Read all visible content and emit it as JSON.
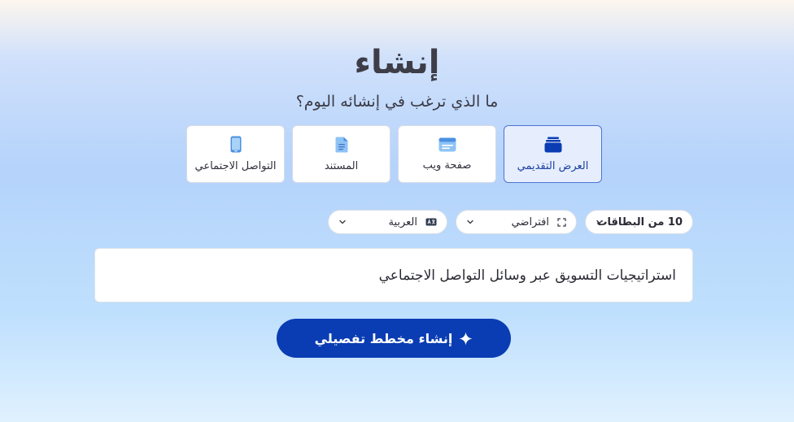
{
  "header": {
    "title": "إنشاء",
    "subtitle": "ما الذي ترغب في إنشائه اليوم؟"
  },
  "types": [
    {
      "label": "العرض التقديمي",
      "icon": "presentation-stack-icon",
      "selected": true
    },
    {
      "label": "صفحة ويب",
      "icon": "webpage-icon",
      "selected": false
    },
    {
      "label": "المستند",
      "icon": "document-icon",
      "selected": false
    },
    {
      "label": "التواصل الاجتماعي",
      "icon": "phone-icon",
      "selected": false
    }
  ],
  "options": {
    "cards": {
      "value": "10 من البطاقات",
      "icon": "chevron-down-icon"
    },
    "theme": {
      "value": "افتراضي",
      "icon": "aspect-ratio-icon"
    },
    "language": {
      "value": "العربية",
      "icon": "translate-icon"
    }
  },
  "prompt": {
    "value": "استراتيجيات التسويق عبر وسائل التواصل الاجتماعي"
  },
  "generate": {
    "label": "إنشاء مخطط تفصيلي",
    "icon": "sparkle-icon"
  },
  "colors": {
    "accent": "#0a3db3",
    "selected_card_bg": "#e6eefe",
    "selected_card_border": "#4c74d6",
    "card_icon_light": "#8ec3f5"
  }
}
